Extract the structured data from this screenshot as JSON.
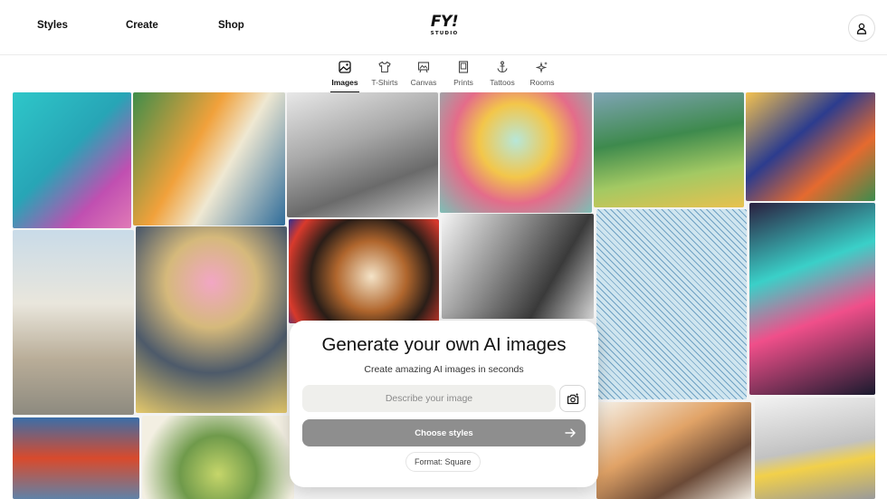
{
  "header": {
    "nav": [
      {
        "label": "Styles"
      },
      {
        "label": "Create"
      },
      {
        "label": "Shop"
      }
    ],
    "logo": {
      "mark": "FY!",
      "sub": "STUDIO"
    },
    "account_icon": "user-icon"
  },
  "categories": [
    {
      "label": "Images",
      "icon": "image-icon",
      "active": true
    },
    {
      "label": "T-Shirts",
      "icon": "tshirt-icon",
      "active": false
    },
    {
      "label": "Canvas",
      "icon": "canvas-icon",
      "active": false
    },
    {
      "label": "Prints",
      "icon": "print-icon",
      "active": false
    },
    {
      "label": "Tattoos",
      "icon": "anchor-icon",
      "active": false
    },
    {
      "label": "Rooms",
      "icon": "sparkle-icon",
      "active": false
    }
  ],
  "generator": {
    "title": "Generate your own AI images",
    "subtitle": "Create amazing AI images in seconds",
    "input_value": "",
    "input_placeholder": "Describe your image",
    "upload_icon": "camera-icon",
    "choose_label": "Choose styles",
    "choose_icon": "arrow-right-icon",
    "format_label": "Format: Square"
  },
  "colors": {
    "button_disabled": "#8e8e8e",
    "input_bg": "#efefec",
    "text": "#111111"
  }
}
